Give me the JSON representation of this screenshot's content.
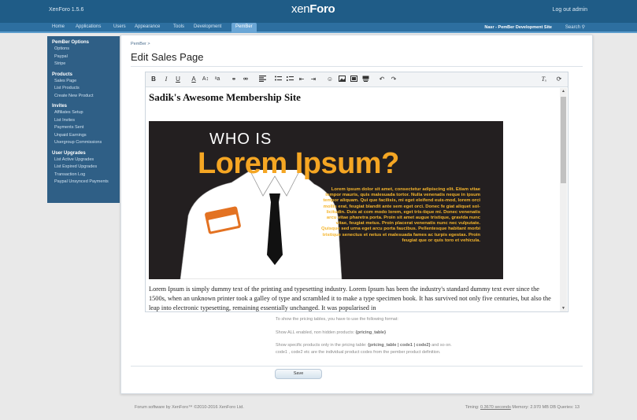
{
  "header": {
    "version": "XenForo 1.5.6",
    "logo_a": "xen",
    "logo_b": "Foro",
    "logout": "Log out admin"
  },
  "nav": {
    "tabs": [
      "Home",
      "Applications",
      "Users",
      "Appearance",
      "Tools",
      "Development",
      "PemBer"
    ],
    "active": "PemBer",
    "site_link": "Nasr - PemBer Development Site",
    "search": "Search"
  },
  "sidebar": {
    "groups": [
      {
        "heading": "PemBer Options",
        "items": [
          "Options",
          "Paypal",
          "Stripe"
        ]
      },
      {
        "heading": "Products",
        "items": [
          "Sales Page",
          "List Products",
          "Create New Product"
        ]
      },
      {
        "heading": "Invites",
        "items": [
          "Affiliates Setup",
          "List Invites",
          "Payments Sent",
          "Unpaid Earnings",
          "Usergroup Commissions"
        ]
      },
      {
        "heading": "User Upgrades",
        "items": [
          "List Active Upgrades",
          "List Expired Upgrades",
          "Transaction Log",
          "Paypal Unsynced Payments"
        ]
      }
    ]
  },
  "main": {
    "breadcrumb": "PemBer >",
    "title": "Edit Sales Page",
    "editor": {
      "heading": "Sadik's Awesome Membership Site",
      "hero_who": "WHO IS",
      "hero_lorem": "Lorem Ipsum?",
      "hero_text": "Lorem ipsum dolor sit amet, consectetur adipiscing elit. Etiam vitae tempor mauris, quis malesuada tortor. Nulla venenatis neque in ipsum tempor aliquam. Qui que facilisis, mi eget eleifend euis-mod, lorem orci mollis erat, feugiat blandit ante sem eget orci. Donec fe giat aliquet sol-licitudin. Duis at com modo lorem, eget tris-tique mi. Donec venenatis arcu vitae pharetra porta. Proin sit amet augue tristique, gravida nunc vitae, feugiat metus. Proin placerat venenatis nunc nec vulputate. Quisque sed urna eget arcu porta faucibus. Pellentesque habitant morbi tristique senectus et netus et malesuada fames ac turpis egestas. Proin feugiat que or quis toro et vehicula.",
      "badge_hello": "Hello",
      "badge_name": "Lorem",
      "body": "Lorem Ipsum is simply dummy text of the printing and typesetting industry. Lorem Ipsum has been the industry's standard dummy text ever since the 1500s, when an unknown printer took a galley of type and scrambled it to make a type specimen book. It has survived not only five centuries, but also the leap into electronic typesetting, remaining essentially unchanged. It was popularised in"
    },
    "hints": {
      "line1": "To show the pricing tables, you have to use the following format:",
      "line2_pre": "Show ALL enabled, non hidden products: ",
      "line2_code": "{pricing_table}",
      "line3_pre": "Show specific products only in the pricing table: ",
      "line3_code": "{pricing_table | code1 | code2}",
      "line3_post": " and so on.",
      "line4": "code1 , code2 etc are the individual product codes from the pember product definition."
    },
    "save_label": "Save"
  },
  "footer": {
    "copyright": "Forum software by XenForo™ ©2010-2016 XenForo Ltd.",
    "timing_label": "Timing: ",
    "timing_value": "0.3670 seconds",
    "stats": " Memory: 2.970 MB DB Queries: 13"
  }
}
